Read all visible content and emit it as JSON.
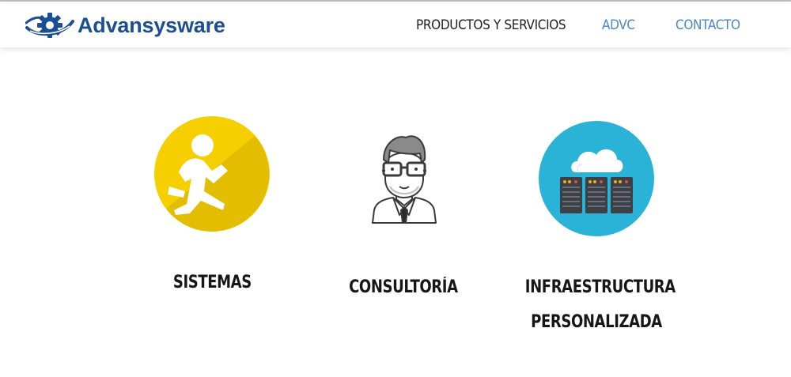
{
  "brand": {
    "name": "Advansysware",
    "logo_icon": "gear-swoosh-icon",
    "primary_color": "#1b4f93"
  },
  "nav": {
    "items": [
      {
        "label": "PRODUCTOS Y SERVICIOS",
        "color": "#1f1f1f"
      },
      {
        "label": "ADVC",
        "color": "#4a86c5"
      },
      {
        "label": "CONTACTO",
        "color": "#4a86c5"
      }
    ]
  },
  "services": [
    {
      "icon": "running-person-icon",
      "icon_color": "#f5cf00",
      "label_lines": [
        "SISTEMAS"
      ]
    },
    {
      "icon": "consultant-person-icon",
      "icon_color": "#555555",
      "label_lines": [
        "CONSULTORÍA"
      ]
    },
    {
      "icon": "cloud-servers-icon",
      "icon_color": "#2ab3d6",
      "label_lines": [
        "INFRAESTRUCTURA",
        "PERSONALIZADA"
      ]
    }
  ]
}
